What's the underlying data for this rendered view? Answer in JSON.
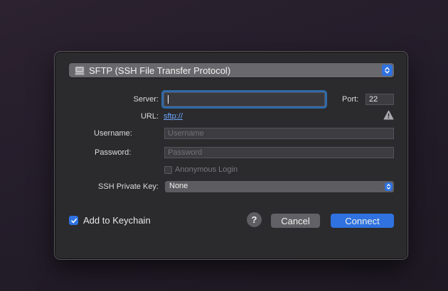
{
  "protocol": {
    "selected": "SFTP (SSH File Transfer Protocol)",
    "icon": "network-drive-icon"
  },
  "server": {
    "label": "Server:",
    "value": ""
  },
  "port": {
    "label": "Port:",
    "value": "22"
  },
  "url": {
    "label": "URL:",
    "value": "sftp://",
    "warning_icon": "warning-icon"
  },
  "username": {
    "label": "Username:",
    "placeholder": "Username",
    "value": ""
  },
  "password": {
    "label": "Password:",
    "placeholder": "Password",
    "value": ""
  },
  "anonymous": {
    "label": "Anonymous Login",
    "checked": false
  },
  "ssh_key": {
    "label": "SSH Private Key:",
    "selected": "None"
  },
  "keychain": {
    "label": "Add to Keychain",
    "checked": true
  },
  "buttons": {
    "help": "?",
    "cancel": "Cancel",
    "connect": "Connect"
  },
  "colors": {
    "accent": "#2f72e0",
    "link": "#6fa9ff",
    "dialog_bg": "#2b2a2d"
  }
}
